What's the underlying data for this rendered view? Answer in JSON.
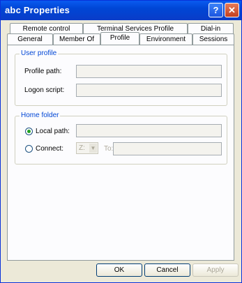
{
  "window": {
    "title": "abc Properties",
    "help_label": "?",
    "close_label": "✕"
  },
  "tabs_row1": [
    {
      "label": "Remote control"
    },
    {
      "label": "Terminal Services Profile"
    },
    {
      "label": "Dial-in"
    }
  ],
  "tabs_row2": [
    {
      "label": "General"
    },
    {
      "label": "Member Of"
    },
    {
      "label": "Profile",
      "active": true
    },
    {
      "label": "Environment"
    },
    {
      "label": "Sessions"
    }
  ],
  "user_profile": {
    "group_title": "User profile",
    "profile_path_label": "Profile path:",
    "profile_path_value": "",
    "logon_script_label": "Logon script:",
    "logon_script_value": ""
  },
  "home_folder": {
    "group_title": "Home folder",
    "local_path_label": "Local path:",
    "local_path_value": "",
    "local_path_selected": true,
    "connect_label": "Connect:",
    "connect_selected": false,
    "drive_value": "Z:",
    "to_label": "To:",
    "to_value": ""
  },
  "buttons": {
    "ok": "OK",
    "cancel": "Cancel",
    "apply": "Apply"
  }
}
